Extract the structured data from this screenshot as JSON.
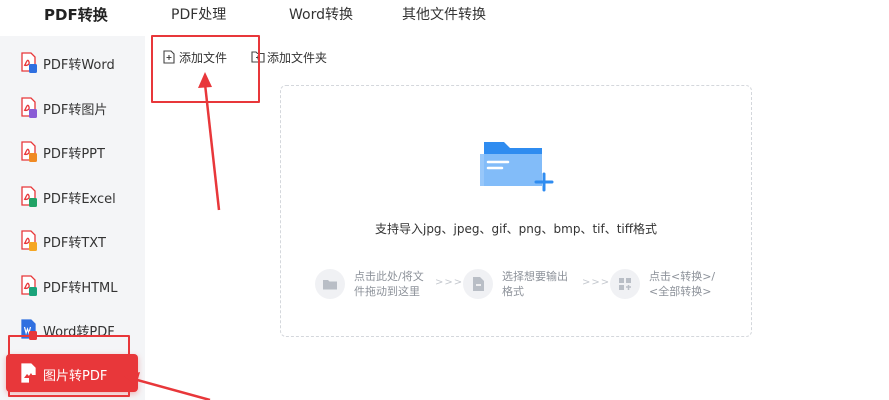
{
  "topnav": {
    "tabs": [
      {
        "label": "PDF转换"
      },
      {
        "label": "PDF处理"
      },
      {
        "label": "Word转换"
      },
      {
        "label": "其他文件转换"
      }
    ]
  },
  "sidebar": {
    "items": [
      {
        "label": "PDF转Word",
        "badge_color": "#2f6fe0"
      },
      {
        "label": "PDF转图片",
        "badge_color": "#8a5cd6"
      },
      {
        "label": "PDF转PPT",
        "badge_color": "#f08a24"
      },
      {
        "label": "PDF转Excel",
        "badge_color": "#21a366"
      },
      {
        "label": "PDF转TXT",
        "badge_color": "#f5a623"
      },
      {
        "label": "PDF转HTML",
        "badge_color": "#1aa37a"
      },
      {
        "label": "Word转PDF",
        "badge_color": "#e8373a"
      },
      {
        "label": "图片转PDF",
        "badge_color": "#e8373a"
      }
    ],
    "active_index": 7
  },
  "toolbar": {
    "add_file_label": "添加文件",
    "add_folder_label": "添加文件夹"
  },
  "dropzone": {
    "formats_text": "支持导入jpg、jpeg、gif、png、bmp、tif、tiff格式",
    "steps": [
      {
        "line1": "点击此处/将文",
        "line2": "件拖动到这里"
      },
      {
        "line1": "选择想要输出",
        "line2": "格式"
      },
      {
        "line1": "点击<转换>/",
        "line2": "<全部转换>"
      }
    ]
  },
  "colors": {
    "accent": "#e8373a",
    "folder_blue": "#2f8cf0",
    "muted_text": "#8d929a"
  }
}
